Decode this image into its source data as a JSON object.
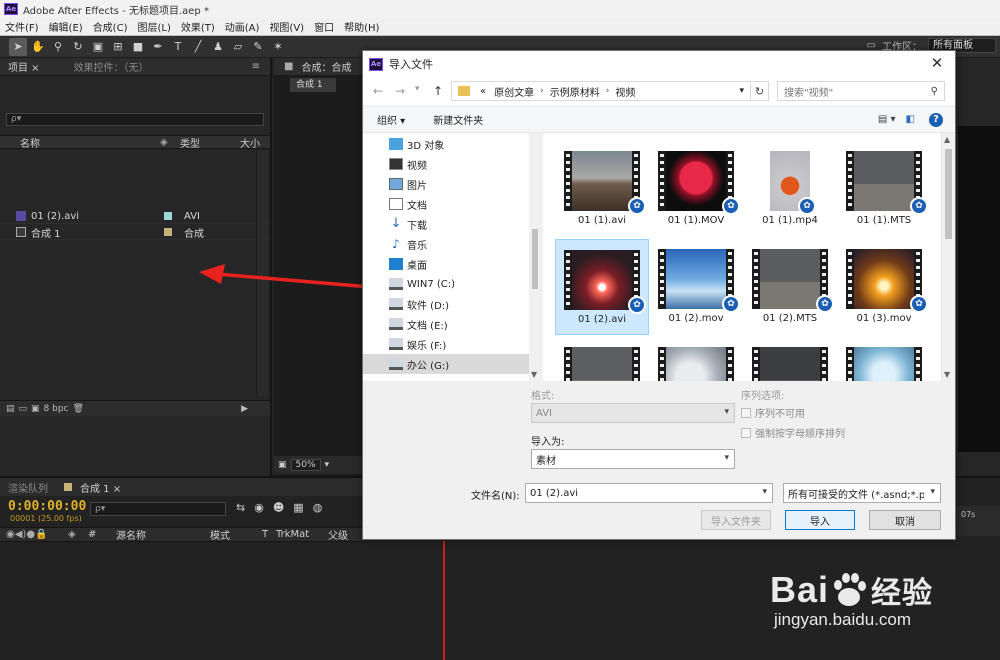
{
  "app": {
    "logo": "Ae",
    "title": "Adobe After Effects - 无标题项目.aep *"
  },
  "menu": [
    "文件(F)",
    "编辑(E)",
    "合成(C)",
    "图层(L)",
    "效果(T)",
    "动画(A)",
    "视图(V)",
    "窗口",
    "帮助(H)"
  ],
  "toolbar": {
    "align_label": "对齐",
    "workspace_label": "工作区：",
    "workspace_value": "所有面板"
  },
  "project_panel": {
    "tabs": [
      "项目 ×",
      "效果控件：（无）"
    ],
    "search_placeholder": "ρ▾",
    "columns": [
      "名称",
      "类型",
      "大小"
    ],
    "items": [
      {
        "name": "01 (2).avi",
        "type": "AVI",
        "color": "#9fd6d6"
      },
      {
        "name": "合成 1",
        "type": "合成",
        "color": "#c7b27a"
      }
    ],
    "bpc": "8 bpc"
  },
  "comp_panel": {
    "tab": "合成：合成",
    "subtab": "合成 1",
    "zoom": "50%"
  },
  "timeline": {
    "tabs": [
      "渲染队列",
      "合成 1 ×"
    ],
    "timecode": "0:00:00:00",
    "fps": "00001 (25.00 fps)",
    "search_placeholder": "ρ▾",
    "columns": [
      "#",
      "源名称",
      "模式",
      "T",
      "TrkMat",
      "父级"
    ],
    "ruler": "07s"
  },
  "dialog": {
    "logo": "Ae",
    "title": "导入文件",
    "close": "✕",
    "address": [
      "«",
      "原创文章",
      "示例原材料",
      "视频"
    ],
    "search_placeholder": "搜索\"视频\"",
    "commands": {
      "organize": "组织 ▾",
      "new_folder": "新建文件夹"
    },
    "tree": [
      {
        "label": "3D 对象",
        "icon": "cube-icon"
      },
      {
        "label": "视频",
        "icon": "video-icon"
      },
      {
        "label": "图片",
        "icon": "picture-icon"
      },
      {
        "label": "文档",
        "icon": "document-icon"
      },
      {
        "label": "下载",
        "icon": "download-icon"
      },
      {
        "label": "音乐",
        "icon": "music-icon"
      },
      {
        "label": "桌面",
        "icon": "desktop-icon"
      },
      {
        "label": "WIN7 (C:)",
        "icon": "drive-icon"
      },
      {
        "label": "软件 (D:)",
        "icon": "drive-icon"
      },
      {
        "label": "文档 (E:)",
        "icon": "drive-icon"
      },
      {
        "label": "娱乐 (F:)",
        "icon": "drive-icon"
      },
      {
        "label": "办公 (G:)",
        "icon": "drive-icon"
      }
    ],
    "files": [
      {
        "name": "01 (1).avi",
        "look": "beach"
      },
      {
        "name": "01 (1).MOV",
        "look": "rose"
      },
      {
        "name": "01 (1).mp4",
        "look": "apple"
      },
      {
        "name": "01 (1).MTS",
        "look": "pots"
      },
      {
        "name": "01 (2).avi",
        "look": "spark"
      },
      {
        "name": "01 (2).mov",
        "look": "sky"
      },
      {
        "name": "01 (2).MTS",
        "look": "pots"
      },
      {
        "name": "01 (3).mov",
        "look": "sunset"
      },
      {
        "name": "",
        "look": "cup"
      },
      {
        "name": "",
        "look": "cloud"
      },
      {
        "name": "",
        "look": "dark"
      },
      {
        "name": "",
        "look": "frost"
      }
    ],
    "format_label": "格式:",
    "format_value": "AVI",
    "sequence_label": "序列选项:",
    "seq_unavailable": "序列不可用",
    "seq_alpha": "强制按字母顺序排列",
    "import_as_label": "导入为:",
    "import_as_value": "素材",
    "filename_label": "文件名(N):",
    "filename_value": "01 (2).avi",
    "filter_value": "所有可接受的文件 (*.asnd;*.pr",
    "btn_import_folder": "导入文件夹",
    "btn_import": "导入",
    "btn_cancel": "取消"
  },
  "watermark": {
    "brand_a": "Bai",
    "brand_b": "经验",
    "url": "jingyan.baidu.com"
  }
}
